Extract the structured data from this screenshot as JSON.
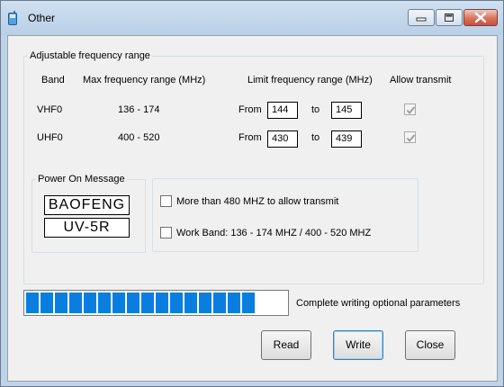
{
  "window": {
    "title": "Other",
    "icons": {
      "app": "radio-icon",
      "minimize": "minimize-icon",
      "maximize": "maximize-icon",
      "close": "close-icon"
    }
  },
  "frequency_group": {
    "legend": "Adjustable  frequency  range",
    "headers": {
      "band": "Band",
      "max_range": "Max frequency range (MHz)",
      "limit_range": "Limit frequency range (MHz)",
      "allow_transmit": "Allow transmit"
    },
    "rows": [
      {
        "band": "VHF0",
        "max_range": "136 - 174",
        "from_label": "From",
        "from": "144",
        "to_label": "to",
        "to": "145",
        "allow_transmit": true
      },
      {
        "band": "UHF0",
        "max_range": "400 - 520",
        "from_label": "From",
        "from": "430",
        "to_label": "to",
        "to": "439",
        "allow_transmit": true
      }
    ]
  },
  "power_on": {
    "legend": "Power On Message",
    "line1": "BAOFENG",
    "line2": "UV-5R"
  },
  "options": {
    "more_than_480": {
      "label": "More than 480 MHZ to allow transmit",
      "checked": false
    },
    "work_band": {
      "label": "Work Band: 136 - 174 MHZ / 400 - 520 MHZ",
      "checked": false
    }
  },
  "progress": {
    "value_fraction": 1.0,
    "segments": 16,
    "status": "Complete writing optional parameters",
    "color": "#0a7ee0"
  },
  "buttons": {
    "read": "Read",
    "write": "Write",
    "close": "Close"
  }
}
